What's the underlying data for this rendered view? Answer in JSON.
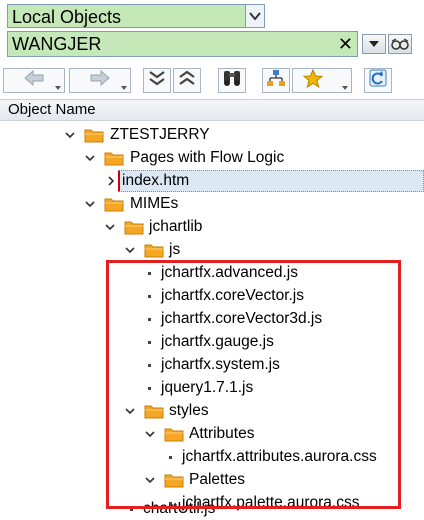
{
  "selector": {
    "value": "Local Objects"
  },
  "search": {
    "value": "WANGJER"
  },
  "column_header": "Object Name",
  "tree": {
    "root": "ZTESTJERRY",
    "pages": "Pages with Flow Logic",
    "index": "index.htm",
    "mimes": "MIMEs",
    "jchartlib": "jchartlib",
    "js": "js",
    "js_files": [
      "jchartfx.advanced.js",
      "jchartfx.coreVector.js",
      "jchartfx.coreVector3d.js",
      "jchartfx.gauge.js",
      "jchartfx.system.js",
      "jquery1.7.1.js"
    ],
    "styles": "styles",
    "attributes": "Attributes",
    "attributes_file": "jchartfx.attributes.aurora.css",
    "palettes": "Palettes",
    "palette_file": "jchartfx.palette.aurora.css",
    "chartutil": "chartUtil.js"
  },
  "colors": {
    "field_bg": "#c5e8b8",
    "folder": "#f5a623",
    "highlight": "#e41f1f"
  }
}
